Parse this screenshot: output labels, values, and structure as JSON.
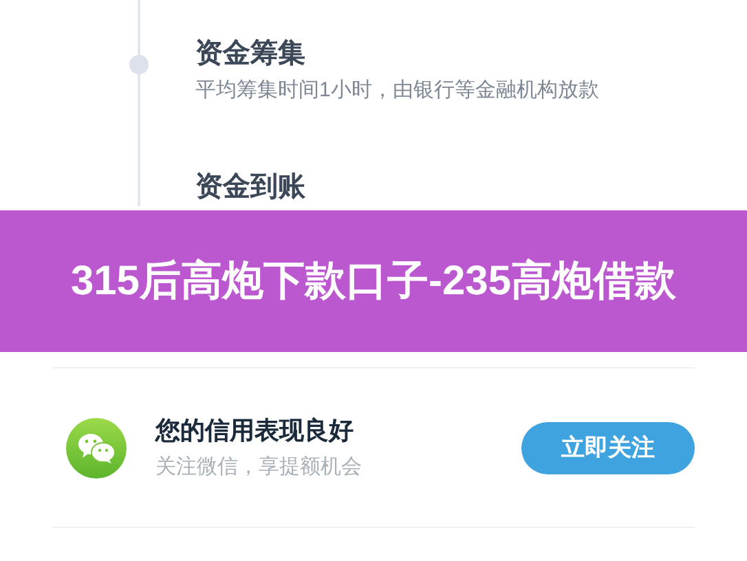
{
  "timeline": [
    {
      "title": "资金筹集",
      "description": "平均筹集时间1小时，由银行等金融机构放款"
    },
    {
      "title": "资金到账"
    }
  ],
  "banner": {
    "title": "315后高炮下款口子-235高炮借款"
  },
  "promo": {
    "title": "您的信用表现良好",
    "subtitle": "关注微信，享提额机会",
    "button": "立即关注"
  }
}
